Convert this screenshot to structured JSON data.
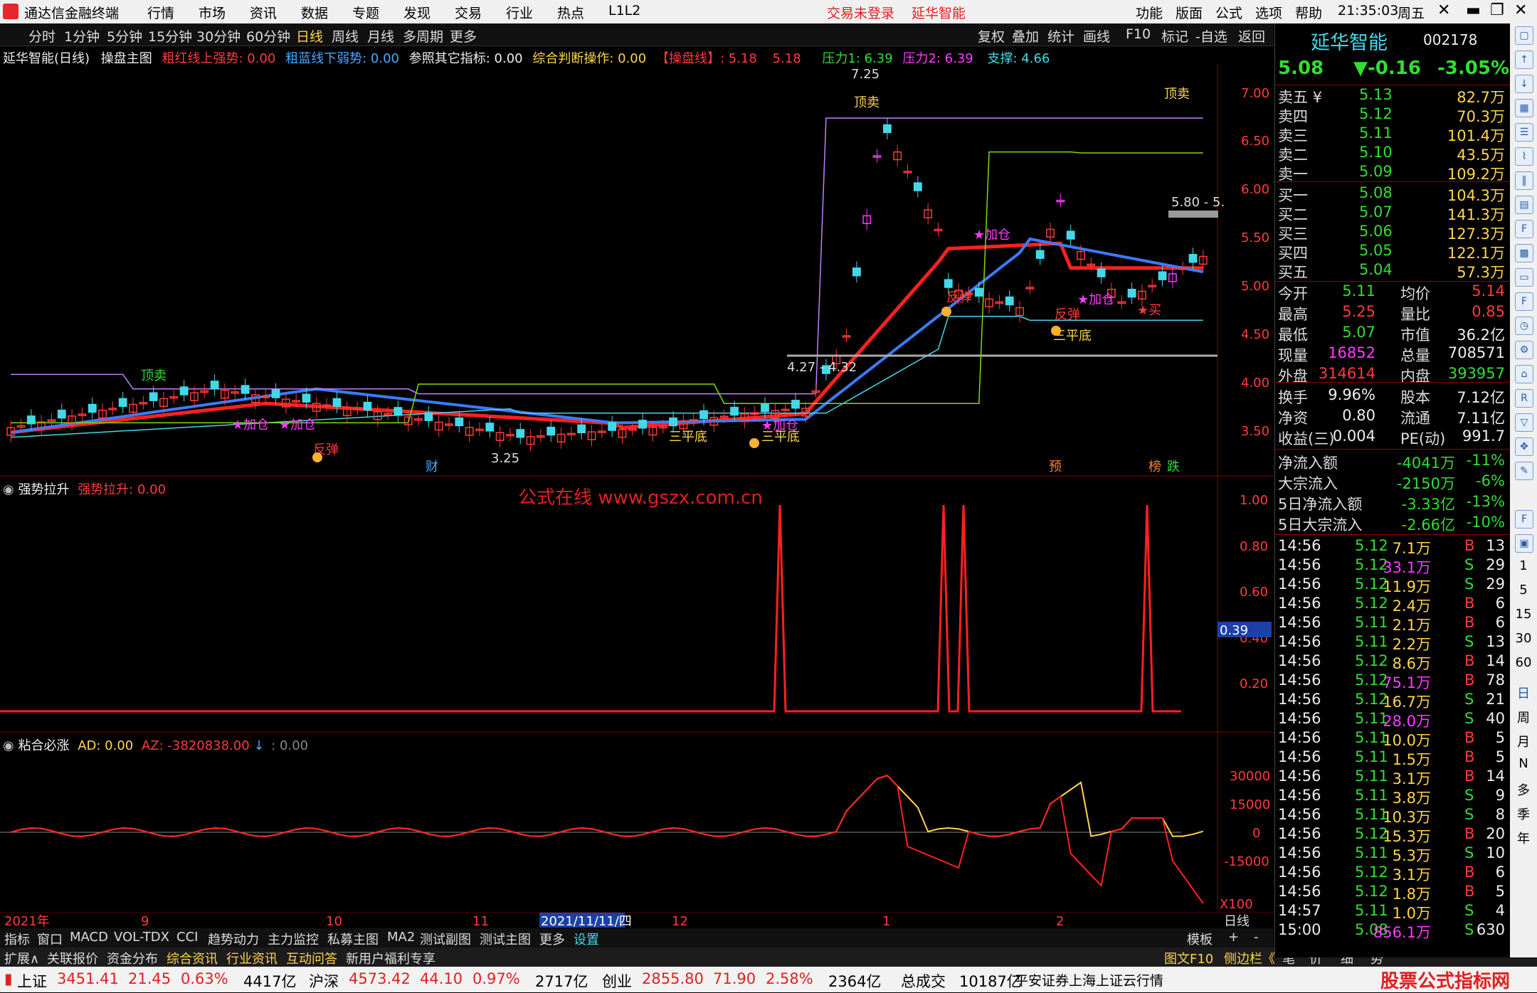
{
  "app": {
    "title": "通达信金融终端",
    "menus": [
      "行情",
      "市场",
      "资讯",
      "数据",
      "专题",
      "发现",
      "交易",
      "行业",
      "热点",
      "L1L2"
    ],
    "center_red": [
      "交易未登录",
      "延华智能"
    ],
    "right_menus": [
      "功能",
      "版面",
      "公式",
      "选项",
      "帮助"
    ],
    "time": "21:35:03",
    "weekday": "周五"
  },
  "periods": {
    "items": [
      "分时",
      "1分钟",
      "5分钟",
      "15分钟",
      "30分钟",
      "60分钟",
      "日线",
      "周线",
      "月线",
      "多周期",
      "更多"
    ],
    "active": "日线",
    "right_items": [
      "复权",
      "叠加",
      "统计",
      "画线",
      "F10",
      "标记",
      "-自选",
      "返回"
    ]
  },
  "main_legend": {
    "stock": "延华智能(日线)",
    "indicator": "操盘主图",
    "red_up": "粗红线上强势: 0.00",
    "blue_down": "粗蓝线下弱势: 0.00",
    "ref": "参照其它指标: 0.00",
    "judge": "综合判断操作: 0.00",
    "op_line": "【操盘线】: 5.18",
    "op_line2": "5.18",
    "p1": "压力1: 6.39",
    "p2": "压力2: 6.39",
    "sup": "支撑: 4.66"
  },
  "main_axis": [
    "7.00",
    "6.50",
    "6.00",
    "5.50",
    "5.00",
    "4.50",
    "4.00",
    "3.50"
  ],
  "annotations": {
    "high": "7.25",
    "low": "3.25",
    "range1": "4.27 - 4.32",
    "range2": "5.80 - 5.",
    "sell_top": "顶卖",
    "add": "★加仓",
    "rebound": "反弹",
    "three_bottom": "三平底",
    "buy": "★买",
    "left_sell": "顶卖",
    "cai": "财",
    "yu": "预",
    "bang": "榜",
    "die": "跌"
  },
  "sub1": {
    "name": "强势拉升",
    "value": "强势拉升: 0.00",
    "axis": [
      "1.00",
      "0.80",
      "0.60",
      "0.40",
      "0.20"
    ],
    "cursor": "0.39",
    "watermark": "公式在线  www.gszx.com.cn"
  },
  "sub2": {
    "name": "粘合必涨",
    "ad": "AD: 0.00",
    "az": "AZ: -3820838.00",
    "extra": ": 0.00",
    "axis": [
      "30000",
      "15000",
      "0",
      "-15000"
    ],
    "scale": "X100"
  },
  "x_axis": {
    "labels": [
      "2021年",
      "9",
      "10",
      "11",
      "2021/11/11/四",
      "12",
      "1",
      "2"
    ],
    "right": "日线"
  },
  "quote": {
    "name": "延华智能",
    "code": "002178",
    "price": "5.08",
    "change": "▼-0.16",
    "pct": "-3.05%",
    "asks": [
      [
        "卖五 ¥",
        "5.13",
        "82.7万"
      ],
      [
        "卖四",
        "5.12",
        "70.3万"
      ],
      [
        "卖三",
        "5.11",
        "101.4万"
      ],
      [
        "卖二",
        "5.10",
        "43.5万"
      ],
      [
        "卖一",
        "5.09",
        "109.2万"
      ]
    ],
    "bids": [
      [
        "买一",
        "5.08",
        "104.3万"
      ],
      [
        "买二",
        "5.07",
        "141.3万"
      ],
      [
        "买三",
        "5.06",
        "127.3万"
      ],
      [
        "买四",
        "5.05",
        "122.1万"
      ],
      [
        "买五",
        "5.04",
        "57.3万"
      ]
    ],
    "stats": [
      [
        "今开",
        "5.11",
        "均价",
        "5.14"
      ],
      [
        "最高",
        "5.25",
        "量比",
        "0.85"
      ],
      [
        "最低",
        "5.07",
        "市值",
        "36.2亿"
      ],
      [
        "现量",
        "16852",
        "总量",
        "708571"
      ],
      [
        "外盘",
        "314614",
        "内盘",
        "393957"
      ]
    ],
    "stats2": [
      [
        "换手",
        "9.96%",
        "股本",
        "7.12亿"
      ],
      [
        "净资",
        "0.80",
        "流通",
        "7.11亿"
      ],
      [
        "收益(三)",
        "0.004",
        "PE(动)",
        "991.7"
      ]
    ],
    "flows": [
      [
        "净流入额",
        "-4041万",
        "-11%"
      ],
      [
        "大宗流入",
        "-2150万",
        "-6%"
      ],
      [
        "5日净流入额",
        "-3.33亿",
        "-13%"
      ],
      [
        "5日大宗流入",
        "-2.66亿",
        "-10%"
      ]
    ],
    "ticks": [
      [
        "14:56",
        "5.12",
        "7.1万",
        "B",
        "13"
      ],
      [
        "14:56",
        "5.12",
        "33.1万",
        "S",
        "29"
      ],
      [
        "14:56",
        "5.12",
        "11.9万",
        "S",
        "29"
      ],
      [
        "14:56",
        "5.12",
        "2.4万",
        "B",
        "6"
      ],
      [
        "14:56",
        "5.11",
        "2.1万",
        "B",
        "6"
      ],
      [
        "14:56",
        "5.11",
        "2.2万",
        "S",
        "13"
      ],
      [
        "14:56",
        "5.12",
        "8.6万",
        "B",
        "14"
      ],
      [
        "14:56",
        "5.12",
        "75.1万",
        "B",
        "78"
      ],
      [
        "14:56",
        "5.12",
        "16.7万",
        "S",
        "21"
      ],
      [
        "14:56",
        "5.11",
        "28.0万",
        "S",
        "40"
      ],
      [
        "14:56",
        "5.11",
        "10.0万",
        "B",
        "5"
      ],
      [
        "14:56",
        "5.11",
        "1.5万",
        "B",
        "5"
      ],
      [
        "14:56",
        "5.11",
        "3.1万",
        "B",
        "14"
      ],
      [
        "14:56",
        "5.11",
        "3.8万",
        "S",
        "9"
      ],
      [
        "14:56",
        "5.11",
        "10.3万",
        "S",
        "8"
      ],
      [
        "14:56",
        "5.12",
        "15.3万",
        "B",
        "20"
      ],
      [
        "14:56",
        "5.11",
        "5.3万",
        "S",
        "10"
      ],
      [
        "14:56",
        "5.12",
        "3.1万",
        "B",
        "6"
      ],
      [
        "14:56",
        "5.12",
        "1.8万",
        "B",
        "5"
      ],
      [
        "14:57",
        "5.11",
        "1.0万",
        "S",
        "4"
      ],
      [
        "15:00",
        "5.08",
        "856.1万",
        "S",
        "630"
      ]
    ]
  },
  "sidebar": {
    "labels": [
      "日",
      "周",
      "月",
      "N",
      "多",
      "季",
      "年"
    ],
    "sec": [
      "1",
      "5",
      "15",
      "30",
      "60"
    ]
  },
  "bottom1": {
    "items": [
      "指标",
      "窗口",
      "MACD",
      "VOL-TDX",
      "CCI",
      "趋势动力",
      "主力监控",
      "私募主图",
      "MA2",
      "测试副图",
      "测试主图",
      "更多",
      "设置"
    ],
    "right": [
      "模板",
      "+",
      "-"
    ]
  },
  "bottom2": {
    "items": [
      "扩展∧",
      "关联报价",
      "资金分布",
      "综合资讯",
      "行业资讯",
      "互动问答",
      "新用户福利专享"
    ],
    "right": [
      "图文F10",
      "侧边栏《",
      "笔",
      "价",
      "细",
      "势"
    ]
  },
  "status": {
    "sh": [
      "上证",
      "3451.41",
      "21.45",
      "0.63%",
      "4417亿"
    ],
    "sz": [
      "沪深",
      "4573.42",
      "44.10",
      "0.97%",
      "2717亿"
    ],
    "cy": [
      "创业",
      "2855.80",
      "71.90",
      "2.58%",
      "2364亿"
    ],
    "total": [
      "总成交",
      "10187亿"
    ],
    "broker": "平安证券上海上证云行情",
    "watermark": "股票公式指标网",
    "watermark_url": "www.gszx.com"
  }
}
